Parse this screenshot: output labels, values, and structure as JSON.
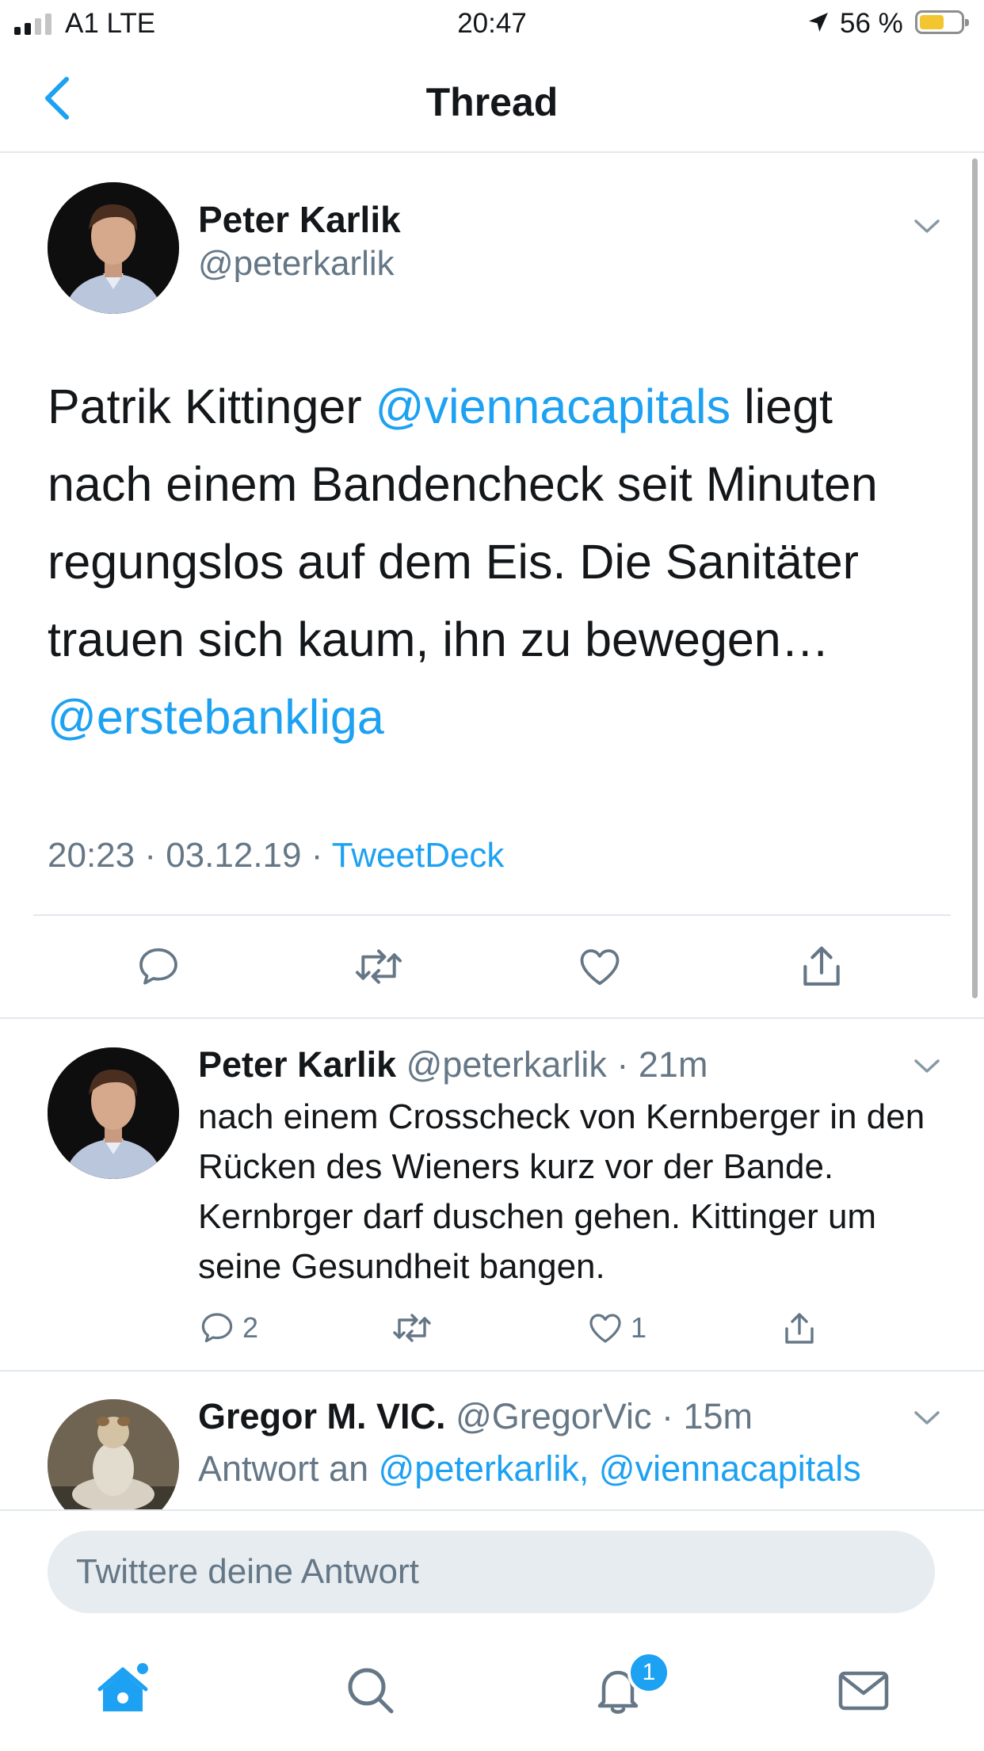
{
  "status_bar": {
    "carrier": "A1 LTE",
    "time": "20:47",
    "battery_percent": "56 %"
  },
  "nav": {
    "title": "Thread"
  },
  "main_tweet": {
    "name": "Peter Karlik",
    "handle": "@peterkarlik",
    "text_1": "Patrik Kittinger ",
    "mention_1": "@viennacapitals",
    "text_2": " liegt nach einem Bandencheck seit Minuten regungslos auf dem Eis. Die Sanitäter trauen sich kaum, ihn zu bewegen… ",
    "mention_2": "@erstebankliga",
    "date": "20:23 · 03.12.19 · ",
    "source": "TweetDeck"
  },
  "reply_1": {
    "name": "Peter Karlik",
    "handle_time": "@peterkarlik · 21m",
    "text": "nach einem Crosscheck von Kernberger in den Rücken des Wieners kurz vor der Bande. Kernbrger darf duschen gehen. Kittinger um seine Gesundheit bangen.",
    "reply_count": "2",
    "like_count": "1"
  },
  "reply_2": {
    "name": "Gregor M. VIC.",
    "handle_time": "@GregorVic · 15m",
    "reply_prefix": "Antwort an ",
    "reply_mentions": "@peterkarlik, @viennacapitals"
  },
  "composer": {
    "placeholder": "Twittere deine Antwort"
  },
  "tabbar": {
    "notifications_badge": "1"
  },
  "colors": {
    "accent": "#1da1f2",
    "secondary_text": "#657786",
    "divider": "#e1e8ed"
  }
}
